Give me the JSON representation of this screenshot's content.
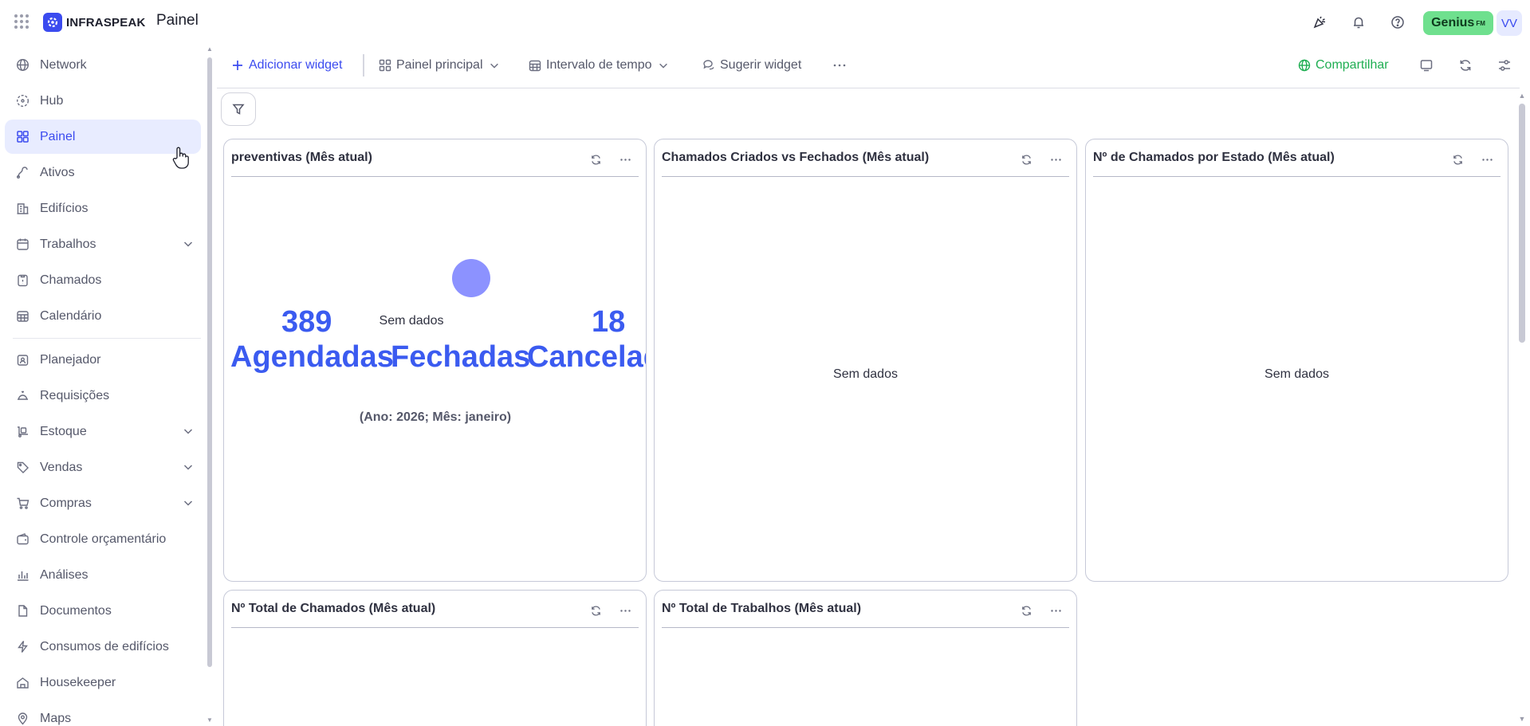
{
  "header": {
    "logo_text": "INFRASPEAK",
    "app_title": "Painel",
    "genius_label": "Genius",
    "genius_sup": "FM",
    "user_initials": "VV"
  },
  "sidebar": {
    "items": [
      {
        "label": "Network"
      },
      {
        "label": "Hub"
      },
      {
        "label": "Painel"
      },
      {
        "label": "Ativos"
      },
      {
        "label": "Edifícios"
      },
      {
        "label": "Trabalhos"
      },
      {
        "label": "Chamados"
      },
      {
        "label": "Calendário"
      },
      {
        "label": "Planejador"
      },
      {
        "label": "Requisições"
      },
      {
        "label": "Estoque"
      },
      {
        "label": "Vendas"
      },
      {
        "label": "Compras"
      },
      {
        "label": "Controle orçamentário"
      },
      {
        "label": "Análises"
      },
      {
        "label": "Documentos"
      },
      {
        "label": "Consumos de edifícios"
      },
      {
        "label": "Housekeeper"
      },
      {
        "label": "Maps"
      }
    ]
  },
  "toolbar": {
    "add_widget": "Adicionar widget",
    "dashboard": "Painel principal",
    "time_range": "Intervalo de tempo",
    "suggest_widget": "Sugerir widget",
    "share": "Compartilhar"
  },
  "widgets": {
    "preventivas": {
      "title": "preventivas (Mês atual)",
      "no_data": "Sem dados",
      "scheduled_value": "389",
      "scheduled_label": "Agendadas",
      "closed_label": "Fechadas",
      "cancelled_value": "18",
      "cancelled_label": "Cancelad",
      "period": "(Ano: 2026; Mês: janeiro)"
    },
    "created_vs_closed": {
      "title": "Chamados Criados vs Fechados (Mês atual)",
      "no_data": "Sem dados"
    },
    "by_state": {
      "title": "Nº de Chamados por Estado (Mês atual)",
      "no_data": "Sem dados"
    },
    "total_tickets": {
      "title": "Nº Total de Chamados (Mês atual)"
    },
    "total_jobs": {
      "title": "Nº Total de Trabalhos (Mês atual)"
    }
  },
  "colors": {
    "accent": "#3b4bef",
    "kpi": "#3b5bf0",
    "share": "#1fae52",
    "genius": "#6fe08e",
    "active_bg": "#e8ecff"
  }
}
